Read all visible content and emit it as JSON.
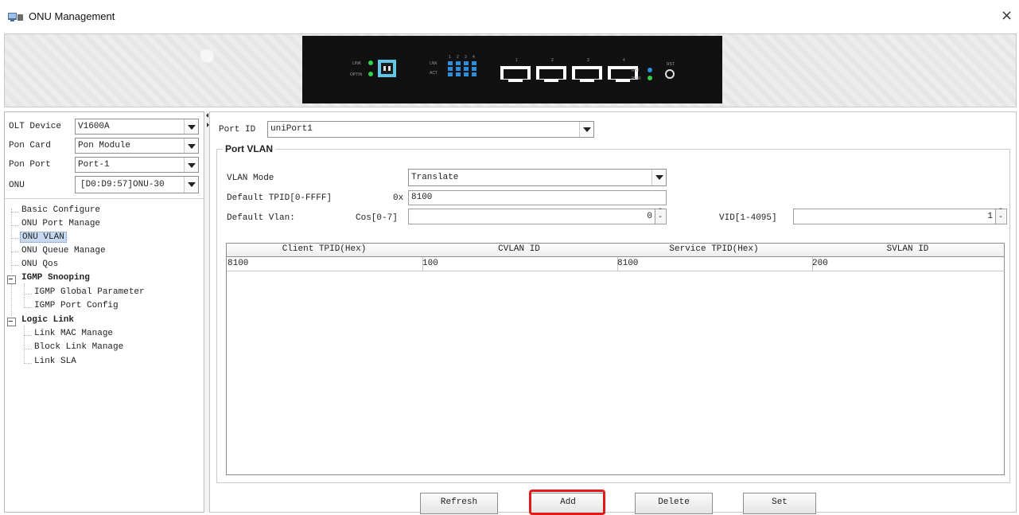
{
  "window": {
    "title": "ONU Management",
    "close_glyph": "×"
  },
  "device_panel": {
    "labels": {
      "link": "LINK",
      "optin": "OPTIN",
      "lnk": "LNK",
      "act": "ACT",
      "rst": "RST",
      "pwr": "PWR",
      "rst_button": "RST"
    },
    "port_numbers": [
      "1",
      "2",
      "3",
      "4"
    ],
    "led_numbers": [
      "1",
      "2",
      "3",
      "4"
    ],
    "colors": {
      "led_green": "#2fd04a",
      "led_blue": "#2b8fe0",
      "fiber": "#5fc6e6"
    }
  },
  "left": {
    "olt_device": {
      "label": "OLT Device",
      "value": "V1600A"
    },
    "pon_card": {
      "label": "Pon Card",
      "value": "Pon Module"
    },
    "pon_port": {
      "label": "Pon Port",
      "value": "Port-1"
    },
    "onu": {
      "label": "ONU",
      "value": "[D0:D9:57]ONU-30"
    },
    "tree": {
      "basic_configure": "Basic Configure",
      "onu_port_manage": "ONU Port Manage",
      "onu_vlan": "ONU VLAN",
      "onu_queue_manage": "ONU Queue Manage",
      "onu_qos": "ONU Qos",
      "igmp_snooping": "IGMP Snooping",
      "igmp_global_parameter": "IGMP Global Parameter",
      "igmp_port_config": "IGMP Port Config",
      "logic_link": "Logic Link",
      "link_mac_manage": "Link MAC Manage",
      "block_link_manage": "Block Link Manage",
      "link_sla": "Link SLA"
    }
  },
  "main": {
    "port_id": {
      "label": "Port ID",
      "value": "uniPort1"
    },
    "group_title": "Port VLAN",
    "vlan_mode": {
      "label": "VLAN Mode",
      "value": "Translate"
    },
    "default_tpid": {
      "label": "Default TPID[0-FFFF]",
      "prefix": "0x",
      "value": "8100"
    },
    "default_vlan": {
      "label": "Default Vlan:",
      "cos_label": "Cos[0-7]",
      "cos_value": "0",
      "vid_label": "VID[1-4095]",
      "vid_value": "1"
    },
    "table": {
      "columns": [
        "Client TPID(Hex)",
        "CVLAN ID",
        "Service TPID(Hex)",
        "SVLAN ID"
      ],
      "rows": [
        [
          "8100",
          "100",
          "8100",
          "200"
        ]
      ]
    },
    "buttons": {
      "refresh": "Refresh",
      "add": "Add",
      "delete": "Delete",
      "set": "Set"
    },
    "highlight_color": "#e21a1a"
  }
}
